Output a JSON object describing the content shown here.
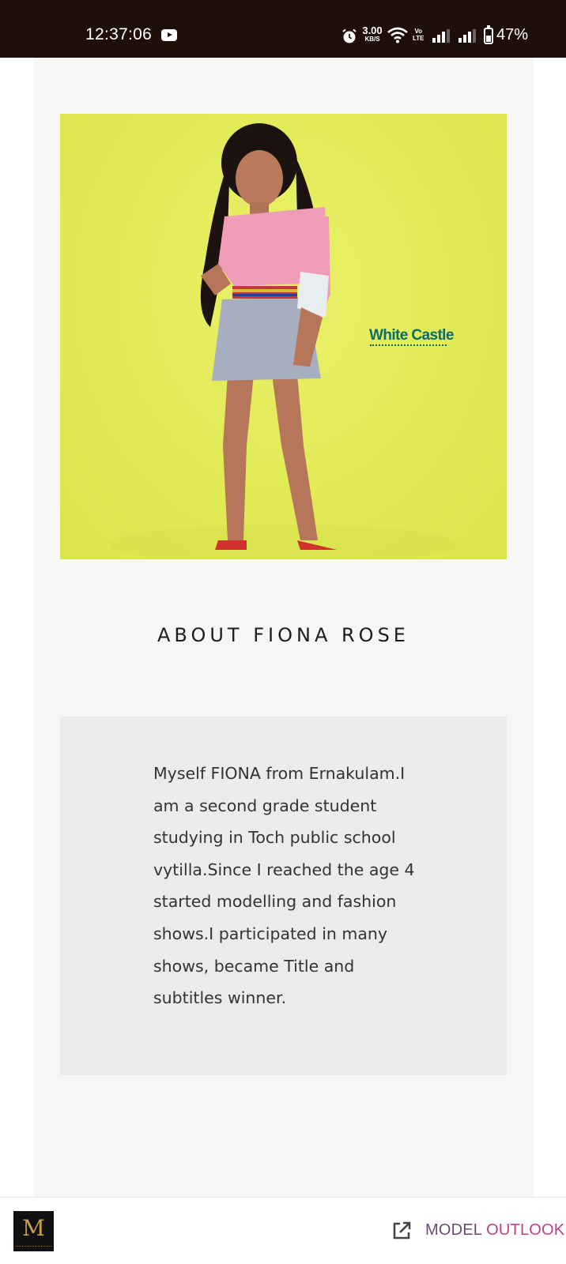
{
  "status_bar": {
    "time": "12:37:06",
    "net_speed_value": "3.00",
    "net_speed_unit": "KB/S",
    "volte_top": "Vo",
    "volte_bottom": "LTE",
    "battery": "47%",
    "icons": [
      "youtube-icon",
      "alarm-icon",
      "wifi-icon",
      "signal-icon",
      "battery-icon"
    ]
  },
  "photo": {
    "brand_logo": "White Castle"
  },
  "about": {
    "heading": "ABOUT FIONA ROSE",
    "bio": "Myself FIONA from Ernakulam.I am a second grade student studying in Toch public school vytilla.Since I reached the age 4 started modelling and fashion shows.I participated in many shows, became Title and subtitles winner."
  },
  "bottom_bar": {
    "logo_mark": "M",
    "link_part1": "MODEL ",
    "link_part2": "OUTLOOK",
    "colors": {
      "link_part1": "#6b4a72",
      "link_part2": "#c0407e"
    }
  }
}
